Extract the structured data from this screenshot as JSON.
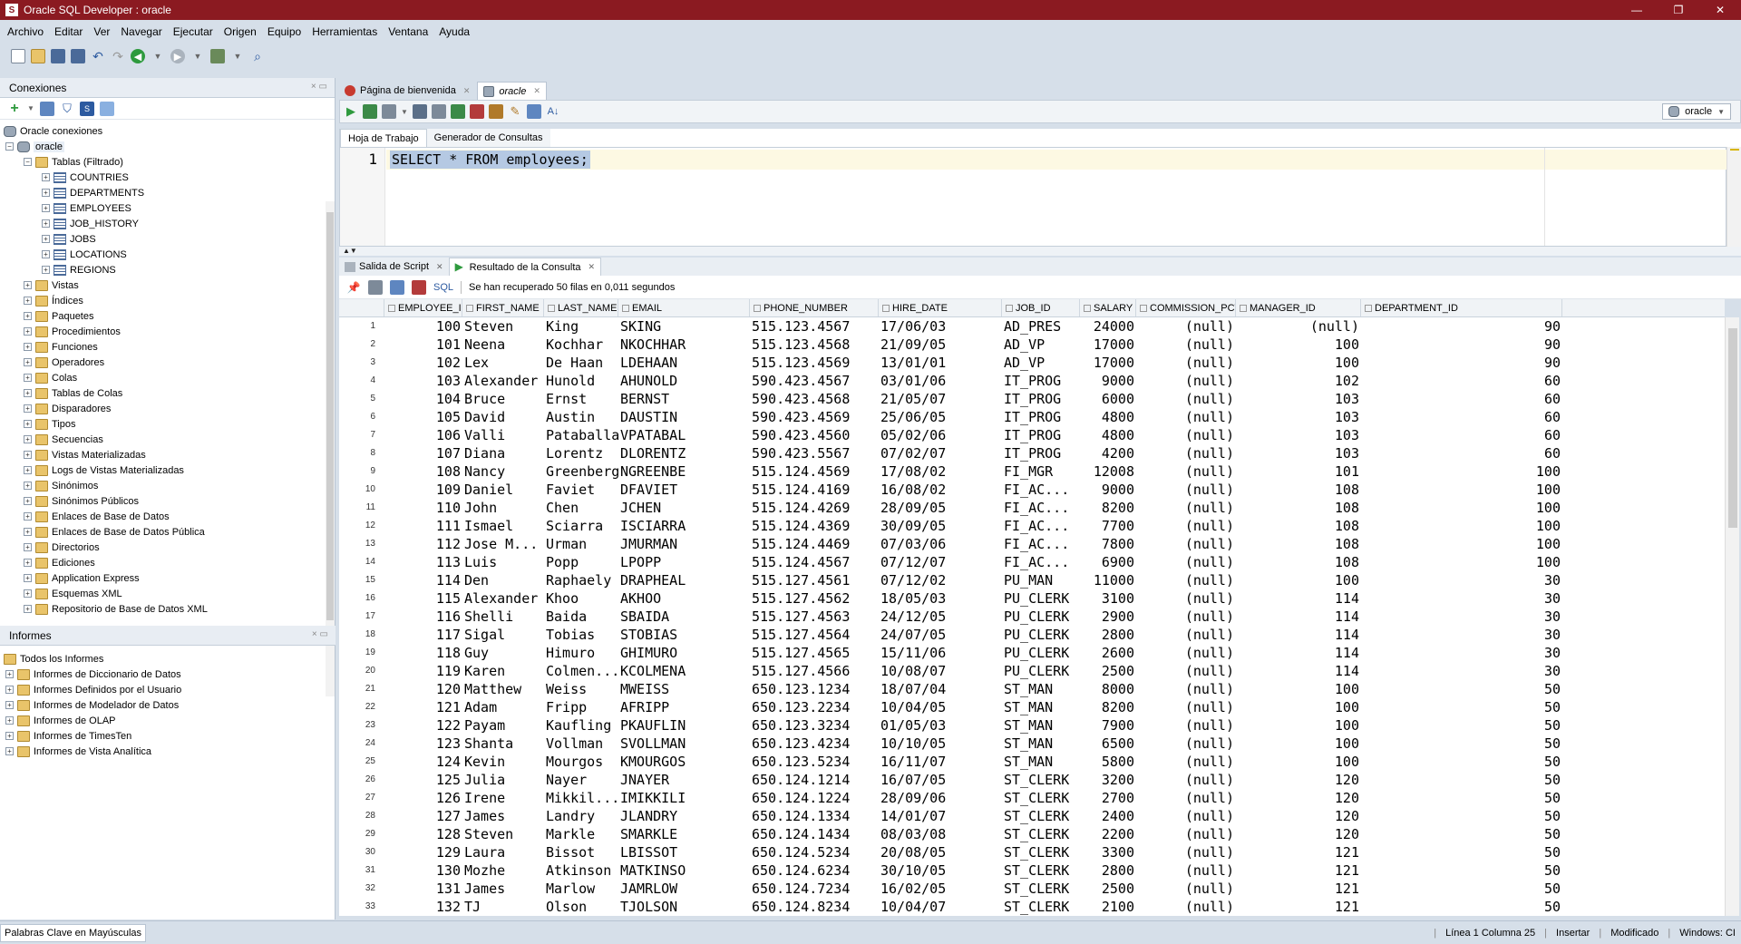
{
  "window": {
    "title": "Oracle SQL Developer : oracle",
    "minimize": "—",
    "maximize": "❐",
    "close": "✕"
  },
  "menu": [
    "Archivo",
    "Editar",
    "Ver",
    "Navegar",
    "Ejecutar",
    "Origen",
    "Equipo",
    "Herramientas",
    "Ventana",
    "Ayuda"
  ],
  "connections": {
    "title": "Conexiones",
    "root": "Oracle conexiones",
    "connection": "oracle",
    "tables_folder": "Tablas (Filtrado)",
    "tables": [
      "COUNTRIES",
      "DEPARTMENTS",
      "EMPLOYEES",
      "JOB_HISTORY",
      "JOBS",
      "LOCATIONS",
      "REGIONS"
    ],
    "folders": [
      "Vistas",
      "Índices",
      "Paquetes",
      "Procedimientos",
      "Funciones",
      "Operadores",
      "Colas",
      "Tablas de Colas",
      "Disparadores",
      "Tipos",
      "Secuencias",
      "Vistas Materializadas",
      "Logs de Vistas Materializadas",
      "Sinónimos",
      "Sinónimos Públicos",
      "Enlaces de Base de Datos",
      "Enlaces de Base de Datos Pública",
      "Directorios",
      "Ediciones",
      "Application Express",
      "Esquemas XML",
      "Repositorio de Base de Datos XML"
    ]
  },
  "reports": {
    "title": "Informes",
    "root": "Todos los Informes",
    "items": [
      "Informes de Diccionario de Datos",
      "Informes Definidos por el Usuario",
      "Informes de Modelador de Datos",
      "Informes de OLAP",
      "Informes de TimesTen",
      "Informes de Vista Analítica"
    ]
  },
  "doc_tabs": {
    "welcome": "Página de bienvenida",
    "oracle": "oracle"
  },
  "editor": {
    "connection": "oracle",
    "tab_worksheet": "Hoja de Trabajo",
    "tab_query_builder": "Generador de Consultas",
    "line_number": "1",
    "sql": "SELECT * FROM employees;"
  },
  "results": {
    "tab_script": "Salida de Script",
    "tab_query": "Resultado de la Consulta",
    "sql_label": "SQL",
    "status": "Se han recuperado 50 filas en 0,011 segundos",
    "columns": [
      "EMPLOYEE_ID",
      "FIRST_NAME",
      "LAST_NAME",
      "EMAIL",
      "PHONE_NUMBER",
      "HIRE_DATE",
      "JOB_ID",
      "SALARY",
      "COMMISSION_PCT",
      "MANAGER_ID",
      "DEPARTMENT_ID"
    ],
    "rows": [
      [
        "1",
        "100",
        "Steven",
        "King",
        "SKING",
        "515.123.4567",
        "17/06/03",
        "AD_PRES",
        "24000",
        "(null)",
        "(null)",
        "90"
      ],
      [
        "2",
        "101",
        "Neena",
        "Kochhar",
        "NKOCHHAR",
        "515.123.4568",
        "21/09/05",
        "AD_VP",
        "17000",
        "(null)",
        "100",
        "90"
      ],
      [
        "3",
        "102",
        "Lex",
        "De Haan",
        "LDEHAAN",
        "515.123.4569",
        "13/01/01",
        "AD_VP",
        "17000",
        "(null)",
        "100",
        "90"
      ],
      [
        "4",
        "103",
        "Alexander",
        "Hunold",
        "AHUNOLD",
        "590.423.4567",
        "03/01/06",
        "IT_PROG",
        "9000",
        "(null)",
        "102",
        "60"
      ],
      [
        "5",
        "104",
        "Bruce",
        "Ernst",
        "BERNST",
        "590.423.4568",
        "21/05/07",
        "IT_PROG",
        "6000",
        "(null)",
        "103",
        "60"
      ],
      [
        "6",
        "105",
        "David",
        "Austin",
        "DAUSTIN",
        "590.423.4569",
        "25/06/05",
        "IT_PROG",
        "4800",
        "(null)",
        "103",
        "60"
      ],
      [
        "7",
        "106",
        "Valli",
        "Pataballa",
        "VPATABAL",
        "590.423.4560",
        "05/02/06",
        "IT_PROG",
        "4800",
        "(null)",
        "103",
        "60"
      ],
      [
        "8",
        "107",
        "Diana",
        "Lorentz",
        "DLORENTZ",
        "590.423.5567",
        "07/02/07",
        "IT_PROG",
        "4200",
        "(null)",
        "103",
        "60"
      ],
      [
        "9",
        "108",
        "Nancy",
        "Greenberg",
        "NGREENBE",
        "515.124.4569",
        "17/08/02",
        "FI_MGR",
        "12008",
        "(null)",
        "101",
        "100"
      ],
      [
        "10",
        "109",
        "Daniel",
        "Faviet",
        "DFAVIET",
        "515.124.4169",
        "16/08/02",
        "FI_AC...",
        "9000",
        "(null)",
        "108",
        "100"
      ],
      [
        "11",
        "110",
        "John",
        "Chen",
        "JCHEN",
        "515.124.4269",
        "28/09/05",
        "FI_AC...",
        "8200",
        "(null)",
        "108",
        "100"
      ],
      [
        "12",
        "111",
        "Ismael",
        "Sciarra",
        "ISCIARRA",
        "515.124.4369",
        "30/09/05",
        "FI_AC...",
        "7700",
        "(null)",
        "108",
        "100"
      ],
      [
        "13",
        "112",
        "Jose M...",
        "Urman",
        "JMURMAN",
        "515.124.4469",
        "07/03/06",
        "FI_AC...",
        "7800",
        "(null)",
        "108",
        "100"
      ],
      [
        "14",
        "113",
        "Luis",
        "Popp",
        "LPOPP",
        "515.124.4567",
        "07/12/07",
        "FI_AC...",
        "6900",
        "(null)",
        "108",
        "100"
      ],
      [
        "15",
        "114",
        "Den",
        "Raphaely",
        "DRAPHEAL",
        "515.127.4561",
        "07/12/02",
        "PU_MAN",
        "11000",
        "(null)",
        "100",
        "30"
      ],
      [
        "16",
        "115",
        "Alexander",
        "Khoo",
        "AKHOO",
        "515.127.4562",
        "18/05/03",
        "PU_CLERK",
        "3100",
        "(null)",
        "114",
        "30"
      ],
      [
        "17",
        "116",
        "Shelli",
        "Baida",
        "SBAIDA",
        "515.127.4563",
        "24/12/05",
        "PU_CLERK",
        "2900",
        "(null)",
        "114",
        "30"
      ],
      [
        "18",
        "117",
        "Sigal",
        "Tobias",
        "STOBIAS",
        "515.127.4564",
        "24/07/05",
        "PU_CLERK",
        "2800",
        "(null)",
        "114",
        "30"
      ],
      [
        "19",
        "118",
        "Guy",
        "Himuro",
        "GHIMURO",
        "515.127.4565",
        "15/11/06",
        "PU_CLERK",
        "2600",
        "(null)",
        "114",
        "30"
      ],
      [
        "20",
        "119",
        "Karen",
        "Colmen...",
        "KCOLMENA",
        "515.127.4566",
        "10/08/07",
        "PU_CLERK",
        "2500",
        "(null)",
        "114",
        "30"
      ],
      [
        "21",
        "120",
        "Matthew",
        "Weiss",
        "MWEISS",
        "650.123.1234",
        "18/07/04",
        "ST_MAN",
        "8000",
        "(null)",
        "100",
        "50"
      ],
      [
        "22",
        "121",
        "Adam",
        "Fripp",
        "AFRIPP",
        "650.123.2234",
        "10/04/05",
        "ST_MAN",
        "8200",
        "(null)",
        "100",
        "50"
      ],
      [
        "23",
        "122",
        "Payam",
        "Kaufling",
        "PKAUFLIN",
        "650.123.3234",
        "01/05/03",
        "ST_MAN",
        "7900",
        "(null)",
        "100",
        "50"
      ],
      [
        "24",
        "123",
        "Shanta",
        "Vollman",
        "SVOLLMAN",
        "650.123.4234",
        "10/10/05",
        "ST_MAN",
        "6500",
        "(null)",
        "100",
        "50"
      ],
      [
        "25",
        "124",
        "Kevin",
        "Mourgos",
        "KMOURGOS",
        "650.123.5234",
        "16/11/07",
        "ST_MAN",
        "5800",
        "(null)",
        "100",
        "50"
      ],
      [
        "26",
        "125",
        "Julia",
        "Nayer",
        "JNAYER",
        "650.124.1214",
        "16/07/05",
        "ST_CLERK",
        "3200",
        "(null)",
        "120",
        "50"
      ],
      [
        "27",
        "126",
        "Irene",
        "Mikkil...",
        "IMIKKILI",
        "650.124.1224",
        "28/09/06",
        "ST_CLERK",
        "2700",
        "(null)",
        "120",
        "50"
      ],
      [
        "28",
        "127",
        "James",
        "Landry",
        "JLANDRY",
        "650.124.1334",
        "14/01/07",
        "ST_CLERK",
        "2400",
        "(null)",
        "120",
        "50"
      ],
      [
        "29",
        "128",
        "Steven",
        "Markle",
        "SMARKLE",
        "650.124.1434",
        "08/03/08",
        "ST_CLERK",
        "2200",
        "(null)",
        "120",
        "50"
      ],
      [
        "30",
        "129",
        "Laura",
        "Bissot",
        "LBISSOT",
        "650.124.5234",
        "20/08/05",
        "ST_CLERK",
        "3300",
        "(null)",
        "121",
        "50"
      ],
      [
        "31",
        "130",
        "Mozhe",
        "Atkinson",
        "MATKINSO",
        "650.124.6234",
        "30/10/05",
        "ST_CLERK",
        "2800",
        "(null)",
        "121",
        "50"
      ],
      [
        "32",
        "131",
        "James",
        "Marlow",
        "JAMRLOW",
        "650.124.7234",
        "16/02/05",
        "ST_CLERK",
        "2500",
        "(null)",
        "121",
        "50"
      ],
      [
        "33",
        "132",
        "TJ",
        "Olson",
        "TJOLSON",
        "650.124.8234",
        "10/04/07",
        "ST_CLERK",
        "2100",
        "(null)",
        "121",
        "50"
      ]
    ]
  },
  "statusbar": {
    "uppercase_keywords": "Palabras Clave en Mayúsculas",
    "position": "Línea 1 Columna 25",
    "mode": "Insertar",
    "modified": "Modificado",
    "os": "Windows: CI"
  }
}
